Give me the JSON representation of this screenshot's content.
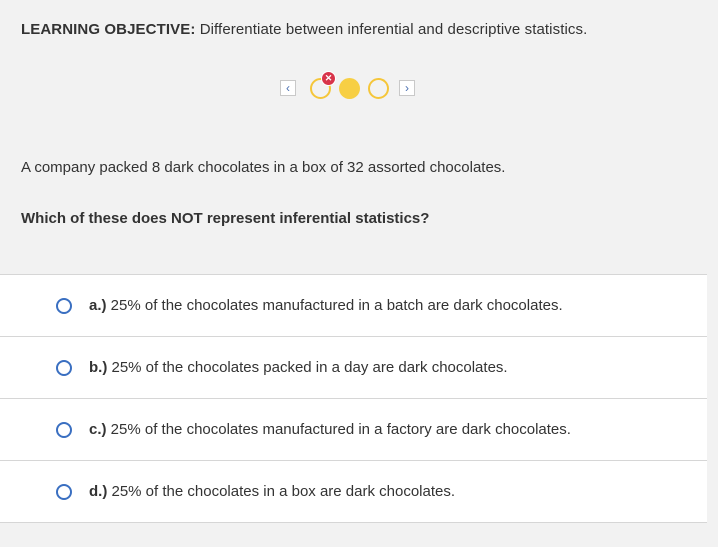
{
  "objective": {
    "label": "LEARNING OBJECTIVE:",
    "text": " Differentiate between inferential and descriptive statistics."
  },
  "navigator": {
    "prev_icon": "chevron-left-icon",
    "next_icon": "chevron-right-icon",
    "dots": [
      {
        "state": "incorrect",
        "badge_icon": "x-icon"
      },
      {
        "state": "current"
      },
      {
        "state": "unanswered"
      }
    ],
    "colors": {
      "dot": "#f7cf44",
      "badge": "#d8344a"
    }
  },
  "stem": "A company packed 8 dark chocolates in a box of 32 assorted chocolates.",
  "question": "Which of these does NOT represent inferential statistics?",
  "options": [
    {
      "letter": "a.)",
      "text": " 25% of the chocolates manufactured in a batch are dark chocolates."
    },
    {
      "letter": "b.)",
      "text": " 25% of the chocolates packed in a day are dark chocolates."
    },
    {
      "letter": "c.)",
      "text": " 25% of the chocolates manufactured in a factory are dark chocolates."
    },
    {
      "letter": "d.)",
      "text": " 25% of the chocolates in a box are dark chocolates."
    }
  ],
  "accent_color": "#3a6fc1"
}
